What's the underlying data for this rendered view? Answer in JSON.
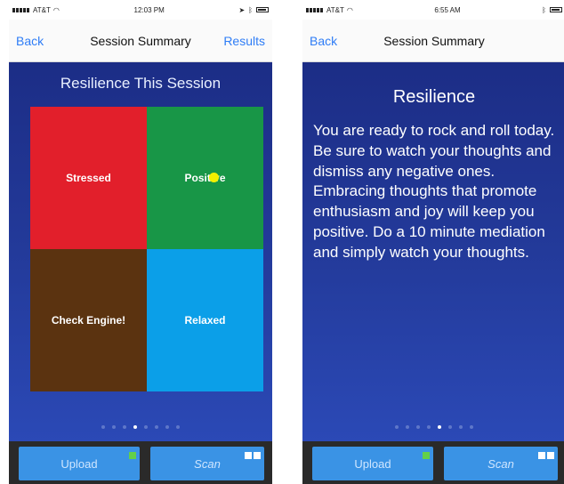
{
  "colors": {
    "nav_accent": "#2f7df6",
    "stressed": "#e21f2b",
    "positive": "#189647",
    "check_engine": "#5b3310",
    "relaxed": "#0b9fe8",
    "marker": "#f2f000",
    "toolbar_button": "#3a93e5",
    "background_gradient": [
      "#1c2d86",
      "#2b49b6"
    ]
  },
  "left_screen": {
    "status": {
      "carrier": "AT&T",
      "time": "12:03 PM"
    },
    "nav": {
      "back": "Back",
      "title": "Session Summary",
      "results": "Results"
    },
    "section_title": "Resilience This Session",
    "quadrants": [
      {
        "label": "Stressed"
      },
      {
        "label": "Positive"
      },
      {
        "label": "Check Engine!"
      },
      {
        "label": "Relaxed"
      }
    ],
    "page_dots": {
      "count": 8,
      "active_index": 3
    },
    "toolbar": {
      "upload": "Upload",
      "scan": "Scan"
    }
  },
  "right_screen": {
    "status": {
      "carrier": "AT&T",
      "time": "6:55 AM"
    },
    "nav": {
      "back": "Back",
      "title": "Session Summary"
    },
    "title": "Resilience",
    "text": "You are ready to rock and roll today. Be sure to watch your thoughts and dismiss any negative ones. Embracing thoughts that promote enthusiasm and joy will keep you positive. Do a 10 minute mediation and simply watch your thoughts.",
    "page_dots": {
      "count": 8,
      "active_index": 4
    },
    "toolbar": {
      "upload": "Upload",
      "scan": "Scan"
    }
  }
}
